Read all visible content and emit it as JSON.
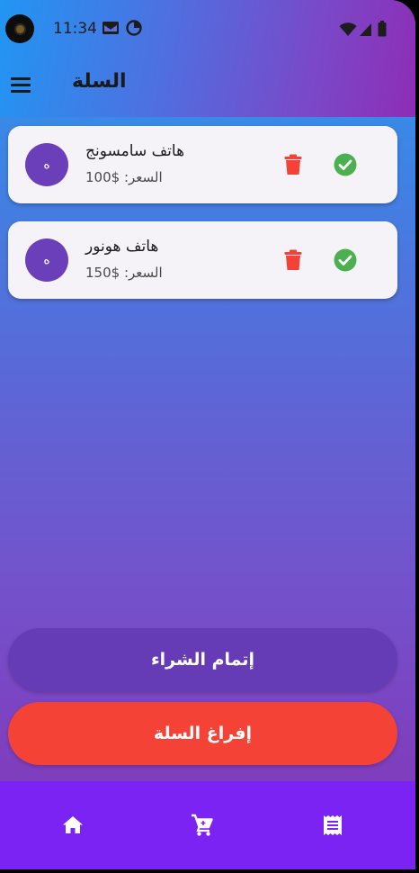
{
  "status_bar": {
    "time": "11:34",
    "icons": [
      "gmail-icon",
      "data-saver-icon",
      "wifi-icon",
      "signal-icon",
      "battery-icon"
    ]
  },
  "app_bar": {
    "title": "السلة",
    "menu_icon": "hamburger-menu-icon"
  },
  "cart": {
    "items": [
      {
        "avatar_letter": "ه",
        "name": "هاتف سامسونج",
        "price": "السعر: $100"
      },
      {
        "avatar_letter": "ه",
        "name": "هاتف هونور",
        "price": "السعر: $150"
      }
    ],
    "item_actions": [
      "delete-icon",
      "check-circle-icon"
    ]
  },
  "actions": {
    "checkout_label": "إتمام الشراء",
    "clear_label": "إفراغ السلة"
  },
  "bottom_nav": {
    "items": [
      "home-icon",
      "cart-icon",
      "receipt-icon"
    ]
  },
  "colors": {
    "accent_purple": "#663cb6",
    "danger_red": "#f44336",
    "success_green": "#4caf50",
    "nav_purple": "#7b23f3",
    "avatar_purple": "#6b3fb9"
  }
}
